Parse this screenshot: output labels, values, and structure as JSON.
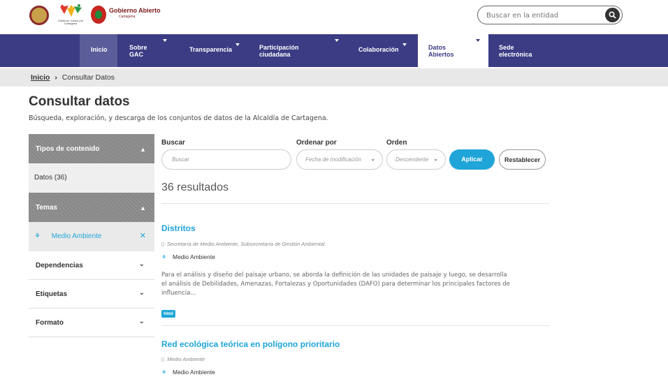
{
  "header": {
    "logo_people_label": "Gobierno Juntos por Cartagena",
    "logo_ga_title": "Gobierno Abierto",
    "logo_ga_sub": "Cartagena",
    "search_placeholder": "Buscar en la entidad"
  },
  "nav": {
    "items": [
      {
        "label": "Inicio"
      },
      {
        "label": "Sobre GAC"
      },
      {
        "label": "Transparencia"
      },
      {
        "label": "Participación ciudadana"
      },
      {
        "label": "Colaboración"
      },
      {
        "label": "Datos Abiertos"
      },
      {
        "label": "Sede electrónica"
      }
    ]
  },
  "breadcrumb": {
    "home": "Inicio",
    "sep": "›",
    "current": "Consultar Datos"
  },
  "page": {
    "title": "Consultar datos",
    "subtitle": "Búsqueda, exploración, y descarga de los conjuntos de datos de la Alcaldía de Cartagena."
  },
  "sidebar": {
    "tipos_label": "Tipos de contenido",
    "datos_item": "Datos (36)",
    "temas_label": "Temas",
    "selected_theme": "Medio Ambiente",
    "dependencias": "Dependencias",
    "etiquetas": "Etiquetas",
    "formato": "Formato"
  },
  "filters": {
    "buscar_label": "Buscar",
    "buscar_placeholder": "Buscar",
    "ordenar_label": "Ordenar por",
    "ordenar_value": "Fecha de modificación",
    "orden_label": "Orden",
    "orden_value": "Descendente",
    "apply": "Aplicar",
    "reset": "Restablecer"
  },
  "results_count": "36 resultados",
  "results": [
    {
      "title": "Distritos",
      "org": "Secretaría de Medio Ambiente, Subsecretaría de Gestión Ambiental",
      "tag": "Medio Ambiente",
      "desc": "Para el análisis y diseño del paisaje urbano, se aborda la definición de las unidades de paisaje y luego, se desarrolla el análisis de Debilidades, Amenazas, Fortalezas y Oportunidades (DAFO) para determinar los principales factores de influencia...",
      "format": "html"
    },
    {
      "title": "Red ecológica teórica en polígono prioritario",
      "org": "Medio Ambiente",
      "tag": "Medio Ambiente"
    }
  ],
  "colors": {
    "nav_bg": "#3b3c84",
    "accent": "#1fa5d8",
    "sidebar_head": "#888888"
  }
}
